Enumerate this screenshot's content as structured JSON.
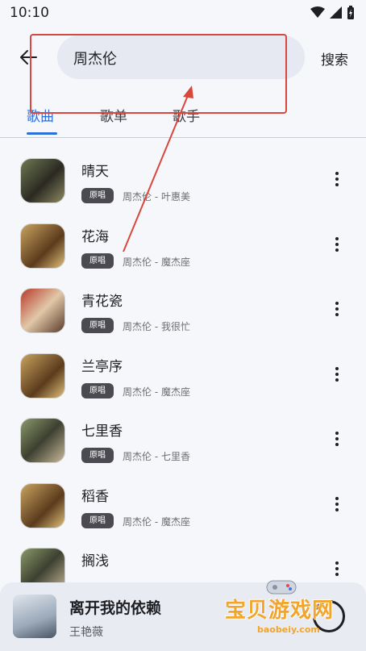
{
  "status": {
    "time": "10:10"
  },
  "search": {
    "value": "周杰伦",
    "button": "搜索"
  },
  "tabs": [
    {
      "label": "歌曲"
    },
    {
      "label": "歌单"
    },
    {
      "label": "歌手"
    }
  ],
  "badge_label": "原唱",
  "songs": [
    {
      "title": "晴天",
      "subtitle": "周杰伦 - 叶惠美"
    },
    {
      "title": "花海",
      "subtitle": "周杰伦 - 魔杰座"
    },
    {
      "title": "青花瓷",
      "subtitle": "周杰伦 - 我很忙"
    },
    {
      "title": "兰亭序",
      "subtitle": "周杰伦 - 魔杰座"
    },
    {
      "title": "七里香",
      "subtitle": "周杰伦 - 七里香"
    },
    {
      "title": "稻香",
      "subtitle": "周杰伦 - 魔杰座"
    },
    {
      "title": "搁浅",
      "subtitle": ""
    }
  ],
  "player": {
    "title": "离开我的依赖",
    "artist": "王艳薇"
  },
  "watermark": {
    "text": "宝贝游戏网",
    "url": "baobeiy.com"
  },
  "colors": {
    "accent": "#2a6fdb",
    "annotation": "#d9463b",
    "watermark": "#f2a52a"
  }
}
